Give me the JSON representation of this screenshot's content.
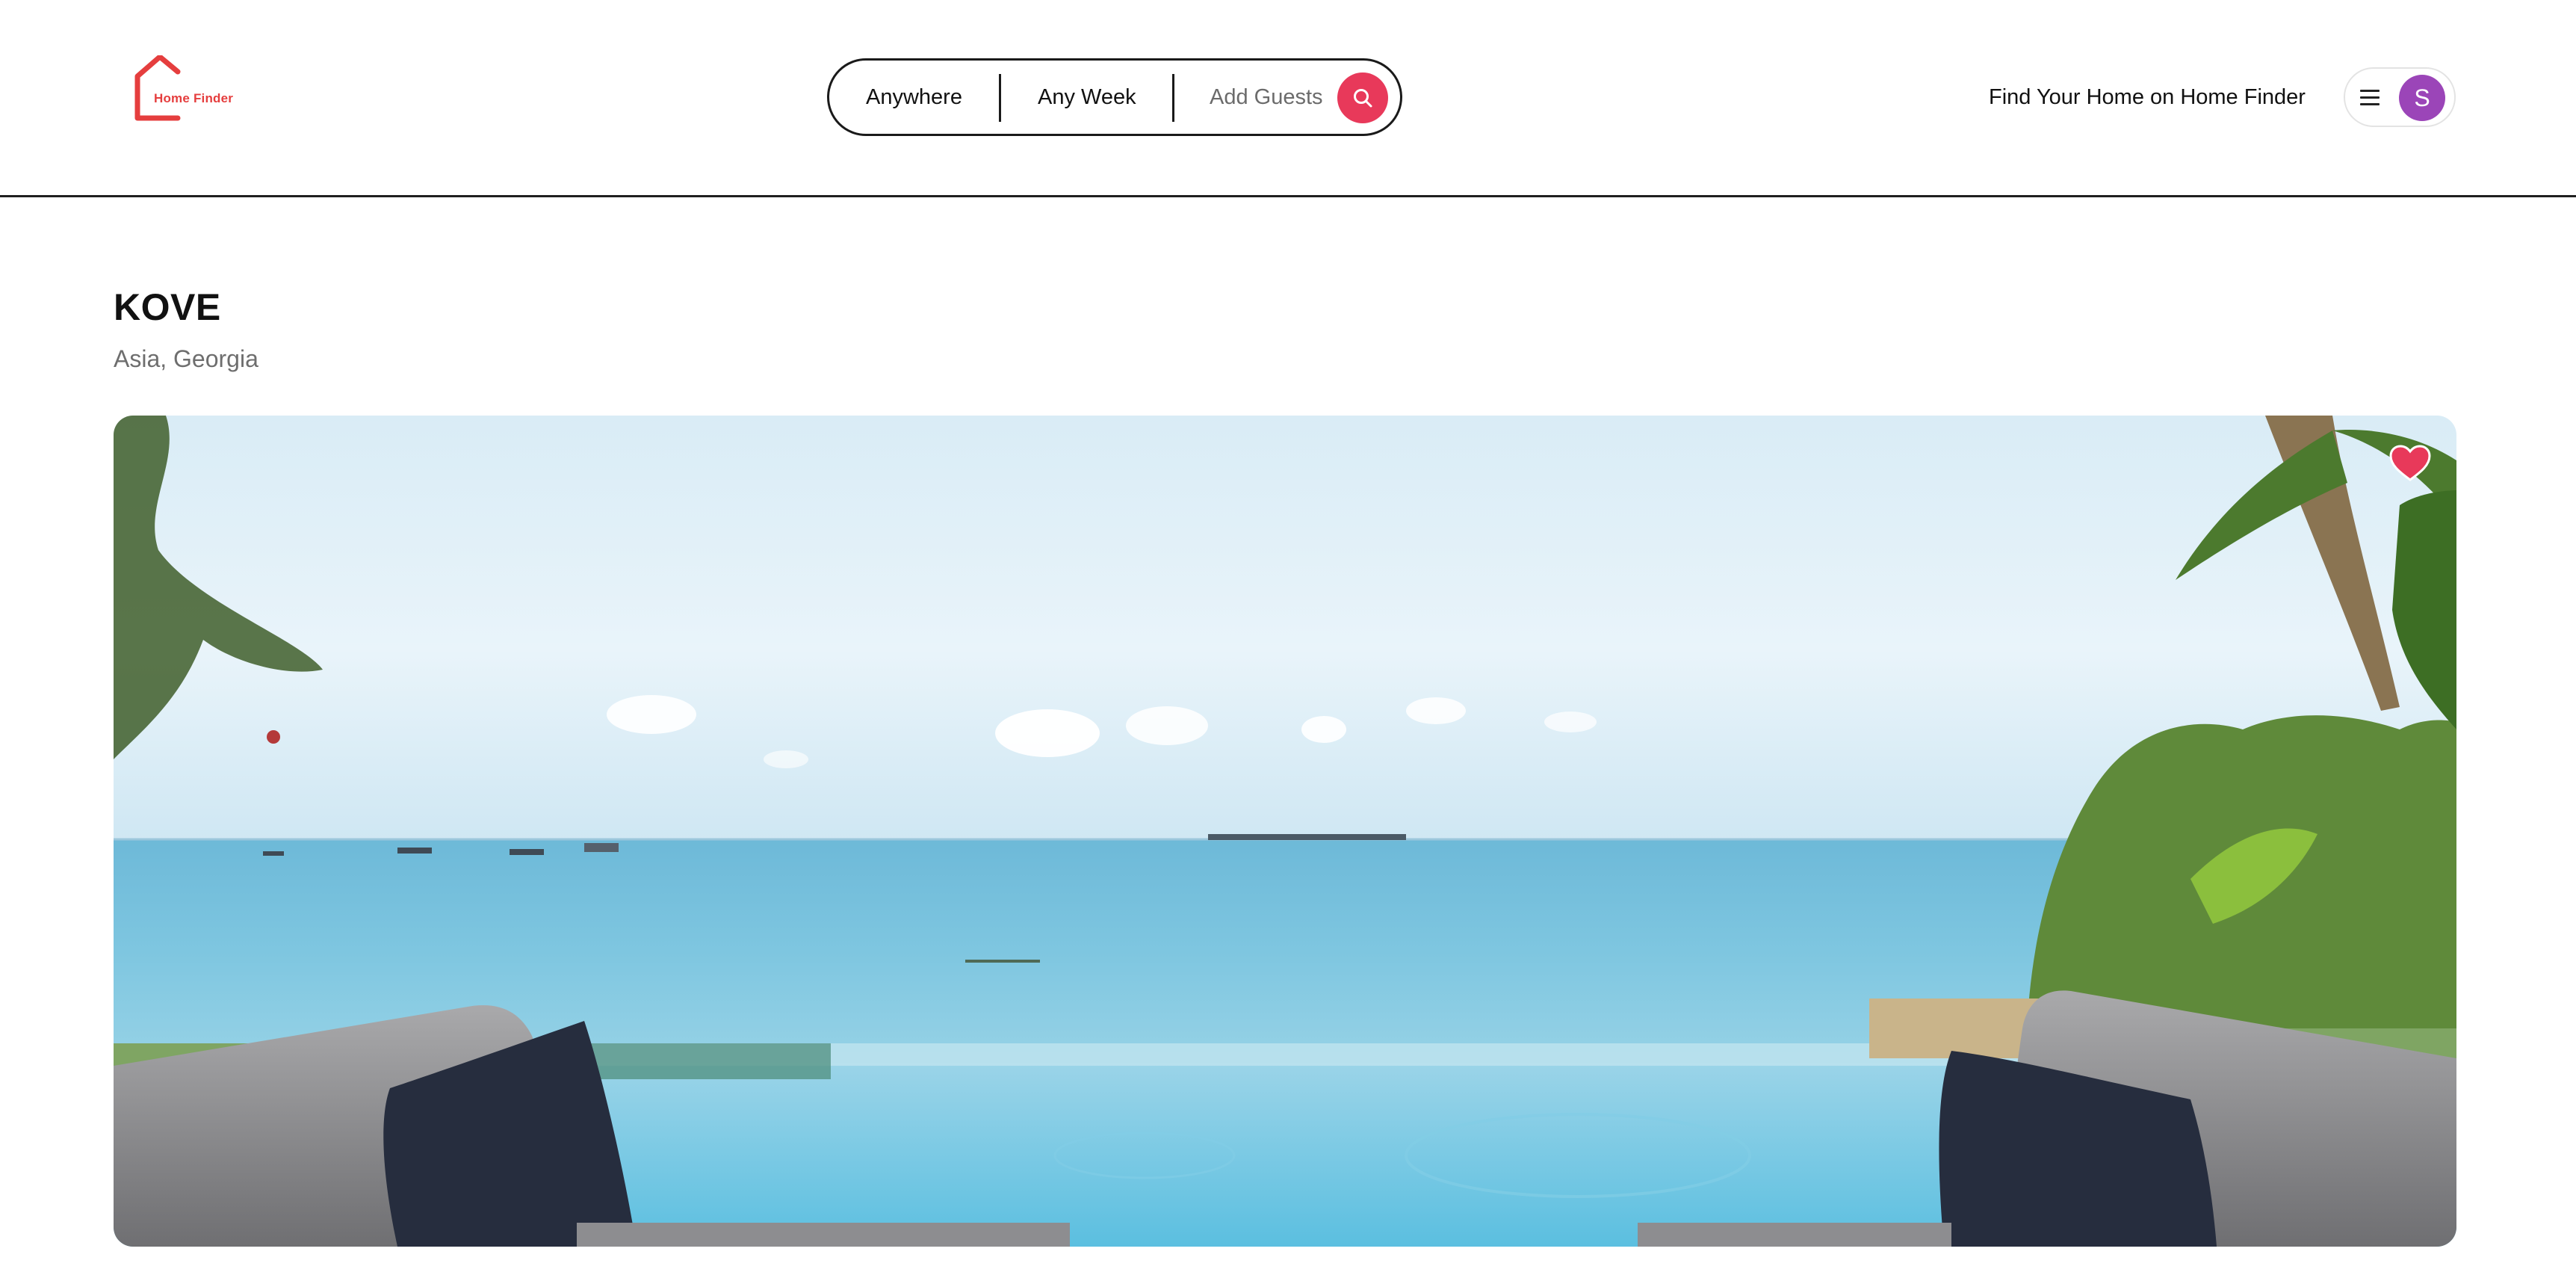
{
  "header": {
    "logo": {
      "text": "Home Finder",
      "color": "#e53e3e"
    },
    "search": {
      "location_label": "Anywhere",
      "dates_label": "Any Week",
      "guests_label": "Add Guests",
      "button_icon": "search-icon",
      "button_color": "#e8395a"
    },
    "host_link": "Find Your Home on Home Finder",
    "user_menu": {
      "menu_icon": "hamburger-icon",
      "avatar_initial": "S",
      "avatar_color": "#9b45b8"
    }
  },
  "listing": {
    "title": "KOVE",
    "location": "Asia, Georgia",
    "image": {
      "description_icon": "beach-pool-photo",
      "favorite_icon": "heart-icon",
      "favorite_color": "#e8395a",
      "favorited": true
    }
  }
}
